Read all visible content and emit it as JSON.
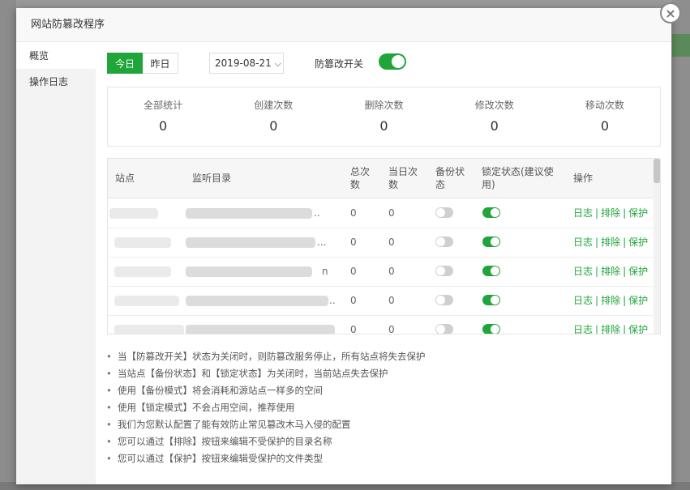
{
  "dialog": {
    "title": "网站防篡改程序",
    "close_icon": "×"
  },
  "sidebar": {
    "items": [
      {
        "label": "概览",
        "active": true
      },
      {
        "label": "操作日志",
        "active": false
      }
    ]
  },
  "toolbar": {
    "tab_today": "今日",
    "tab_yesterday": "昨日",
    "date_value": "2019-08-21",
    "date_chevron": "⌵",
    "toggle_label": "防篡改开关",
    "toggle_on": true
  },
  "stats": [
    {
      "label": "全部统计",
      "value": "0"
    },
    {
      "label": "创建次数",
      "value": "0"
    },
    {
      "label": "删除次数",
      "value": "0"
    },
    {
      "label": "修改次数",
      "value": "0"
    },
    {
      "label": "移动次数",
      "value": "0"
    }
  ],
  "table": {
    "headers": {
      "site": "站点",
      "dir": "监听目录",
      "total": "总次数",
      "today": "当日次数",
      "backup": "备份状态",
      "lock": "锁定状态(建议使用)",
      "ops": "操作"
    },
    "rows": [
      {
        "dir_tail": "..",
        "total": "0",
        "today": "0",
        "backup": false,
        "lock": true
      },
      {
        "dir_tail": "...",
        "total": "0",
        "today": "0",
        "backup": false,
        "lock": true
      },
      {
        "dir_tail": "n",
        "total": "0",
        "today": "0",
        "backup": false,
        "lock": true
      },
      {
        "dir_tail": "..",
        "total": "0",
        "today": "0",
        "backup": false,
        "lock": true
      },
      {
        "dir_tail": "",
        "total": "0",
        "today": "0",
        "backup": false,
        "lock": true
      }
    ],
    "ops": {
      "log": "日志",
      "exclude": "排除",
      "protect": "保护",
      "sep": "|"
    }
  },
  "notes": [
    "当【防篡改开关】状态为关闭时，则防篡改服务停止，所有站点将失去保护",
    "当站点【备份状态】和【锁定状态】为关闭时，当前站点失去保护",
    "使用【备份模式】将会消耗和源站点一样多的空间",
    "使用【锁定模式】不会占用空间，推荐使用",
    "我们为您默认配置了能有效防止常见篡改木马入侵的配置",
    "您可以通过【排除】按钮来编辑不受保护的目录名称",
    "您可以通过【保护】按钮来编辑受保护的文件类型"
  ],
  "colors": {
    "accent": "#20a53a",
    "switch_off": "#cfcfcf"
  }
}
